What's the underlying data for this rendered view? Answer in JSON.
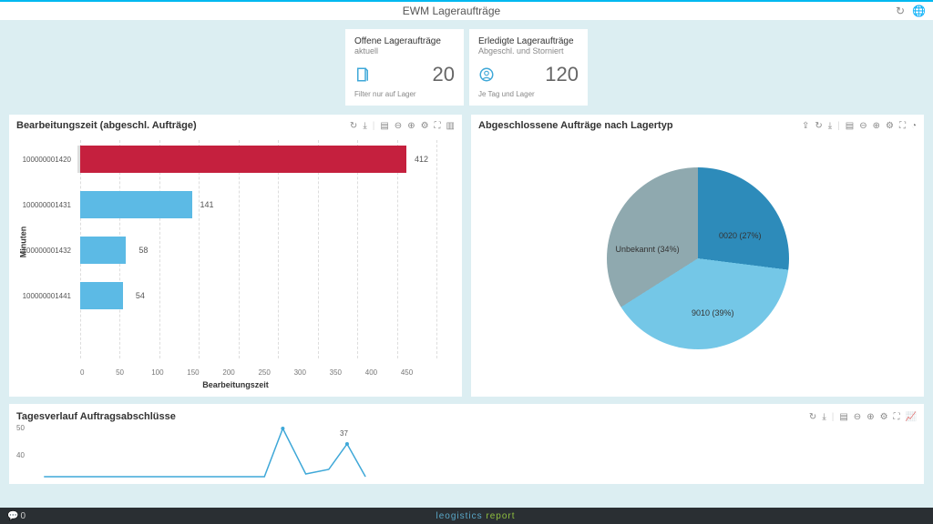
{
  "header": {
    "title": "EWM Lageraufträge"
  },
  "kpi": [
    {
      "title": "Offene Lageraufträge",
      "subtitle": "aktuell",
      "value": "20",
      "footer": "Filter nur auf Lager",
      "icon": "doc"
    },
    {
      "title": "Erledigte Lageraufträge",
      "subtitle": "Abgeschl. und Storniert",
      "value": "120",
      "footer": "Je Tag und Lager",
      "icon": "user"
    }
  ],
  "bar_panel": {
    "title": "Bearbeitungszeit (abgeschl. Aufträge)",
    "ylabel": "Minuten",
    "xlabel": "Bearbeitungszeit"
  },
  "pie_panel": {
    "title": "Abgeschlossene Aufträge nach Lagertyp"
  },
  "line_panel": {
    "title": "Tagesverlauf Auftragsabschlüsse"
  },
  "footer": {
    "feed_count": "0"
  },
  "chart_data": [
    {
      "type": "bar",
      "orientation": "horizontal",
      "categories": [
        "100000001420",
        "100000001431",
        "100000001432",
        "100000001441"
      ],
      "values": [
        412,
        141,
        58,
        54
      ],
      "colors": [
        "#c5203e",
        "#5cbae5",
        "#5cbae5",
        "#5cbae5"
      ],
      "xlabel": "Bearbeitungszeit",
      "ylabel": "Minuten",
      "xticks": [
        0,
        50,
        100,
        150,
        200,
        250,
        300,
        350,
        400,
        450
      ],
      "xlim": [
        0,
        450
      ],
      "highlight": "100000001420"
    },
    {
      "type": "pie",
      "title": "Abgeschlossene Aufträge nach Lagertyp",
      "slices": [
        {
          "label": "0020",
          "percent": 27,
          "color": "#2d8bba"
        },
        {
          "label": "9010",
          "percent": 39,
          "color": "#74c7e7"
        },
        {
          "label": "Unbekannt",
          "percent": 34,
          "color": "#8fa9af"
        }
      ]
    },
    {
      "type": "line",
      "title": "Tagesverlauf Auftragsabschlüsse",
      "yticks": [
        40,
        50
      ],
      "ylim": [
        0,
        50
      ],
      "visible_points": [
        {
          "x_index": 6,
          "y": 48
        },
        {
          "x_index": 8,
          "y": 37,
          "label": "37"
        }
      ],
      "note": "partially visible; peak ~48 and labeled point 37"
    }
  ]
}
